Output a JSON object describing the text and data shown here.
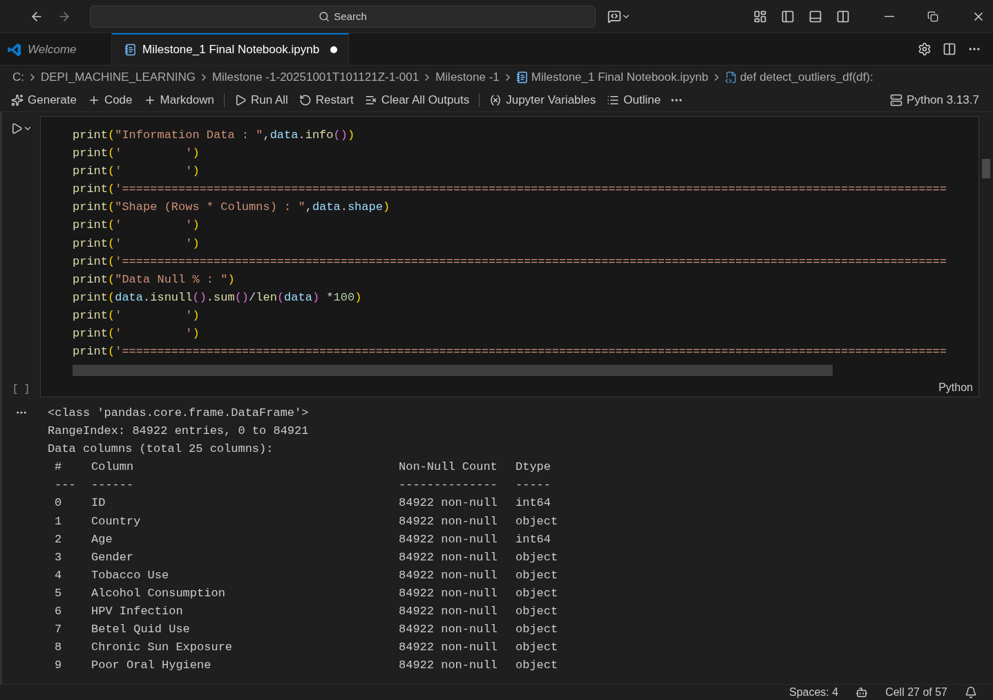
{
  "title_bar": {
    "search": "Search"
  },
  "tabs": [
    {
      "label": "Welcome",
      "kind": "welcome",
      "selected": false,
      "modified": false
    },
    {
      "label": "Milestone_1 Final Notebook.ipynb",
      "kind": "notebook",
      "selected": true,
      "modified": true
    }
  ],
  "breadcrumbs": [
    {
      "label": "C:",
      "kind": "plain"
    },
    {
      "label": "DEPI_MACHINE_LEARNING",
      "kind": "plain"
    },
    {
      "label": "Milestone -1-20251001T101121Z-1-001",
      "kind": "plain"
    },
    {
      "label": "Milestone -1",
      "kind": "plain"
    },
    {
      "label": "Milestone_1 Final Notebook.ipynb",
      "kind": "notebook"
    },
    {
      "label": "def detect_outliers_df(df):",
      "kind": "python"
    }
  ],
  "toolbar": {
    "items": [
      {
        "label": "Generate",
        "kind": "sparkle"
      },
      {
        "label": "Code",
        "kind": "plus"
      },
      {
        "label": "Markdown",
        "kind": "plus"
      },
      {
        "label": "Run All",
        "kind": "run"
      },
      {
        "label": "Restart",
        "kind": "restart"
      },
      {
        "label": "Clear All Outputs",
        "kind": "clear"
      },
      {
        "label": "Jupyter Variables",
        "kind": "variables"
      },
      {
        "label": "Outline",
        "kind": "outline"
      }
    ],
    "kernel": "Python 3.13.7"
  },
  "cell": {
    "execution_count": "[ ]",
    "language": "Python",
    "lines": [
      [
        {
          "t": "print",
          "kind": "fn"
        },
        {
          "t": "(",
          "kind": "br1"
        },
        {
          "t": "\"Information Data : \"",
          "kind": "str"
        },
        {
          "t": ",",
          "kind": "op"
        },
        {
          "t": "data",
          "kind": "var"
        },
        {
          "t": ".",
          "kind": "op"
        },
        {
          "t": "info",
          "kind": "fn"
        },
        {
          "t": "()",
          "kind": "br2"
        },
        {
          "t": ")",
          "kind": "br1"
        }
      ],
      [
        {
          "t": "print",
          "kind": "fn"
        },
        {
          "t": "(",
          "kind": "br1"
        },
        {
          "t": "'         '",
          "kind": "str"
        },
        {
          "t": ")",
          "kind": "br1"
        }
      ],
      [
        {
          "t": "print",
          "kind": "fn"
        },
        {
          "t": "(",
          "kind": "br1"
        },
        {
          "t": "'         '",
          "kind": "str"
        },
        {
          "t": ")",
          "kind": "br1"
        }
      ],
      [
        {
          "t": "print",
          "kind": "fn"
        },
        {
          "t": "(",
          "kind": "br1"
        },
        {
          "t": "'=====================================================================================================================",
          "kind": "str"
        }
      ],
      [
        {
          "t": "print",
          "kind": "fn"
        },
        {
          "t": "(",
          "kind": "br1"
        },
        {
          "t": "\"Shape (Rows * Columns) : \"",
          "kind": "str"
        },
        {
          "t": ",",
          "kind": "op"
        },
        {
          "t": "data",
          "kind": "var"
        },
        {
          "t": ".",
          "kind": "op"
        },
        {
          "t": "shape",
          "kind": "var"
        },
        {
          "t": ")",
          "kind": "br1"
        }
      ],
      [
        {
          "t": "print",
          "kind": "fn"
        },
        {
          "t": "(",
          "kind": "br1"
        },
        {
          "t": "'         '",
          "kind": "str"
        },
        {
          "t": ")",
          "kind": "br1"
        }
      ],
      [
        {
          "t": "print",
          "kind": "fn"
        },
        {
          "t": "(",
          "kind": "br1"
        },
        {
          "t": "'         '",
          "kind": "str"
        },
        {
          "t": ")",
          "kind": "br1"
        }
      ],
      [
        {
          "t": "print",
          "kind": "fn"
        },
        {
          "t": "(",
          "kind": "br1"
        },
        {
          "t": "'=====================================================================================================================",
          "kind": "str"
        }
      ],
      [
        {
          "t": "print",
          "kind": "fn"
        },
        {
          "t": "(",
          "kind": "br1"
        },
        {
          "t": "\"Data Null % : \"",
          "kind": "str"
        },
        {
          "t": ")",
          "kind": "br1"
        }
      ],
      [
        {
          "t": "print",
          "kind": "fn"
        },
        {
          "t": "(",
          "kind": "br1"
        },
        {
          "t": "data",
          "kind": "var"
        },
        {
          "t": ".",
          "kind": "op"
        },
        {
          "t": "isnull",
          "kind": "fn"
        },
        {
          "t": "()",
          "kind": "br2"
        },
        {
          "t": ".",
          "kind": "op"
        },
        {
          "t": "sum",
          "kind": "fn"
        },
        {
          "t": "()",
          "kind": "br2"
        },
        {
          "t": "/",
          "kind": "op"
        },
        {
          "t": "len",
          "kind": "fn"
        },
        {
          "t": "(",
          "kind": "br2"
        },
        {
          "t": "data",
          "kind": "var"
        },
        {
          "t": ")",
          "kind": "br2"
        },
        {
          "t": " *",
          "kind": "op"
        },
        {
          "t": "100",
          "kind": "num"
        },
        {
          "t": ")",
          "kind": "br1"
        }
      ],
      [
        {
          "t": "print",
          "kind": "fn"
        },
        {
          "t": "(",
          "kind": "br1"
        },
        {
          "t": "'         '",
          "kind": "str"
        },
        {
          "t": ")",
          "kind": "br1"
        }
      ],
      [
        {
          "t": "print",
          "kind": "fn"
        },
        {
          "t": "(",
          "kind": "br1"
        },
        {
          "t": "'         '",
          "kind": "str"
        },
        {
          "t": ")",
          "kind": "br1"
        }
      ],
      [
        {
          "t": "print",
          "kind": "fn"
        },
        {
          "t": "(",
          "kind": "br1"
        },
        {
          "t": "'=====================================================================================================================",
          "kind": "str"
        }
      ]
    ]
  },
  "output": {
    "lines": [
      "<class 'pandas.core.frame.DataFrame'>",
      "RangeIndex: 84922 entries, 0 to 84921",
      "Data columns (total 25 columns):"
    ],
    "table": {
      "header": [
        "#",
        "Column",
        "Non-Null Count",
        "Dtype"
      ],
      "rule": [
        "---",
        "------",
        "--------------",
        "-----"
      ],
      "rows": [
        [
          "0",
          "ID",
          "84922 non-null",
          "int64"
        ],
        [
          "1",
          "Country",
          "84922 non-null",
          "object"
        ],
        [
          "2",
          "Age",
          "84922 non-null",
          "int64"
        ],
        [
          "3",
          "Gender",
          "84922 non-null",
          "object"
        ],
        [
          "4",
          "Tobacco Use",
          "84922 non-null",
          "object"
        ],
        [
          "5",
          "Alcohol Consumption",
          "84922 non-null",
          "object"
        ],
        [
          "6",
          "HPV Infection",
          "84922 non-null",
          "object"
        ],
        [
          "7",
          "Betel Quid Use",
          "84922 non-null",
          "object"
        ],
        [
          "8",
          "Chronic Sun Exposure",
          "84922 non-null",
          "object"
        ],
        [
          "9",
          "Poor Oral Hygiene",
          "84922 non-null",
          "object"
        ]
      ]
    }
  },
  "status_bar": {
    "spaces": "Spaces: 4",
    "cell_position": "Cell 27 of 57"
  }
}
